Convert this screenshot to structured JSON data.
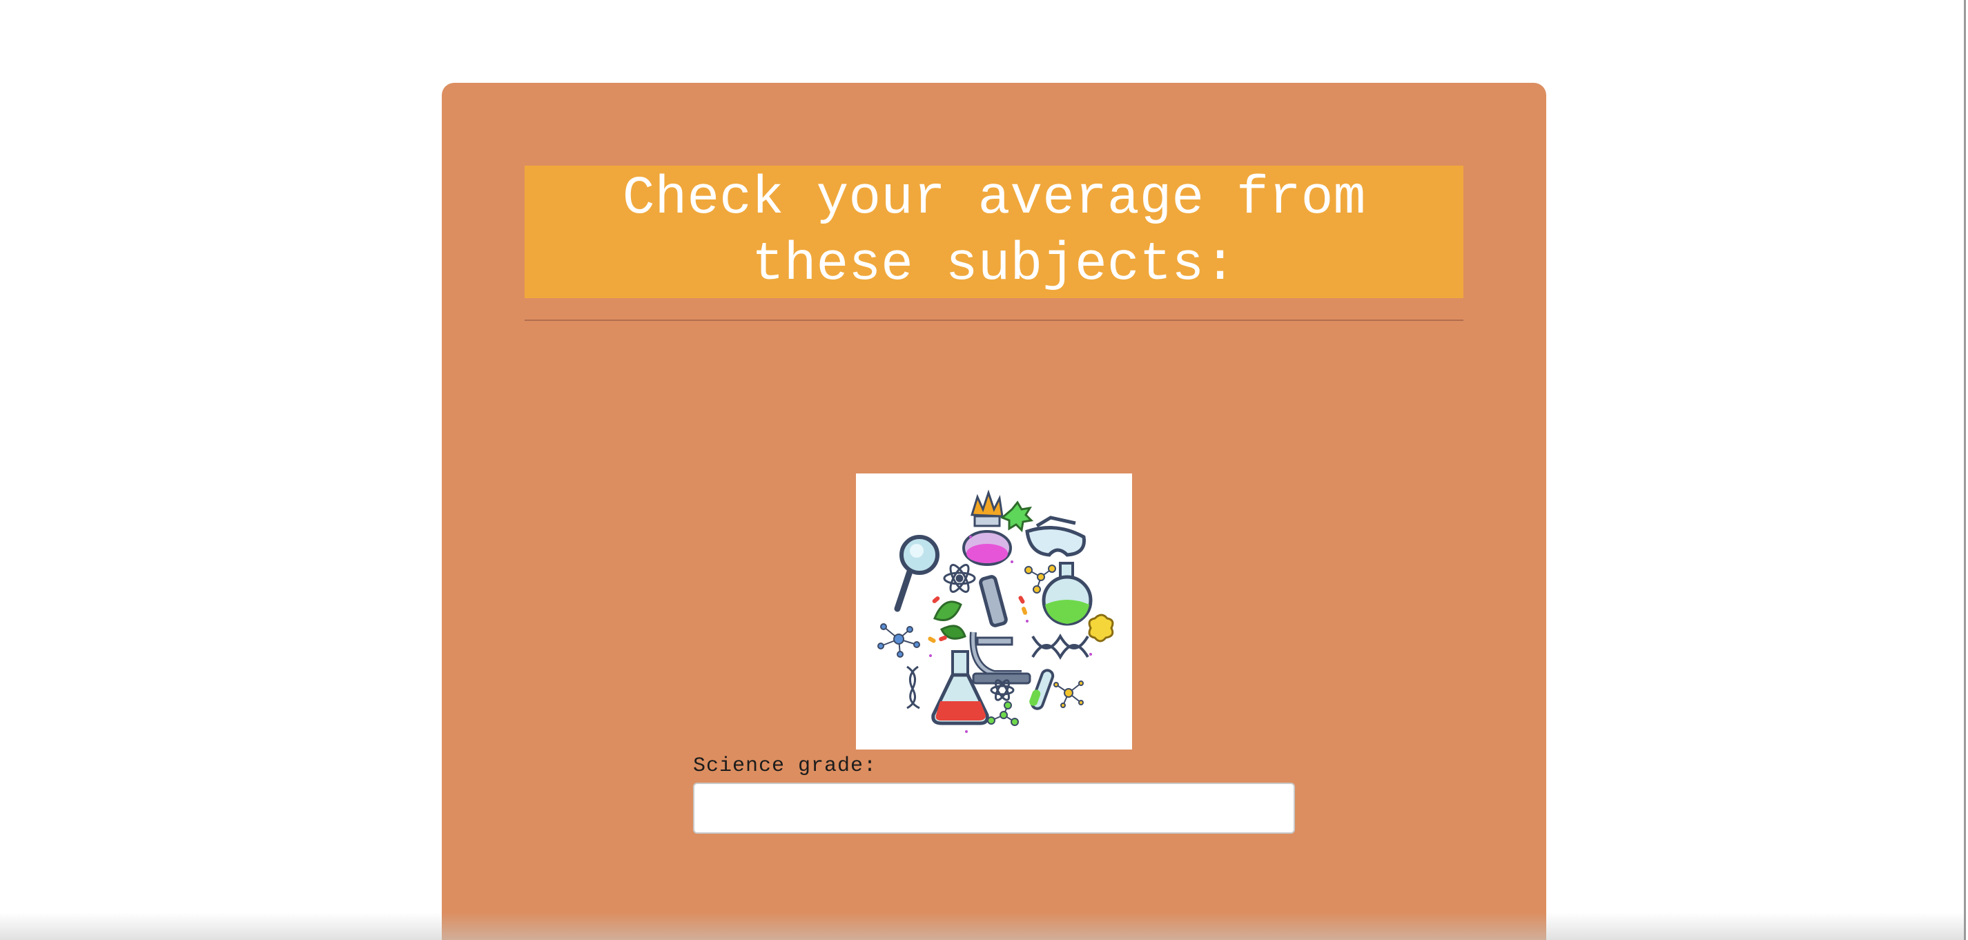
{
  "form": {
    "title": "Check your average from these subjects:",
    "subjects": [
      {
        "name": "science",
        "label": "Science grade:",
        "value": "",
        "image_icon": "science-lab-icon"
      }
    ]
  },
  "colors": {
    "page_background": "#ffffff",
    "card_background": "#dc8e60",
    "title_background": "#f0a83c",
    "title_text": "#ffffff",
    "divider": "#b26e4e"
  }
}
